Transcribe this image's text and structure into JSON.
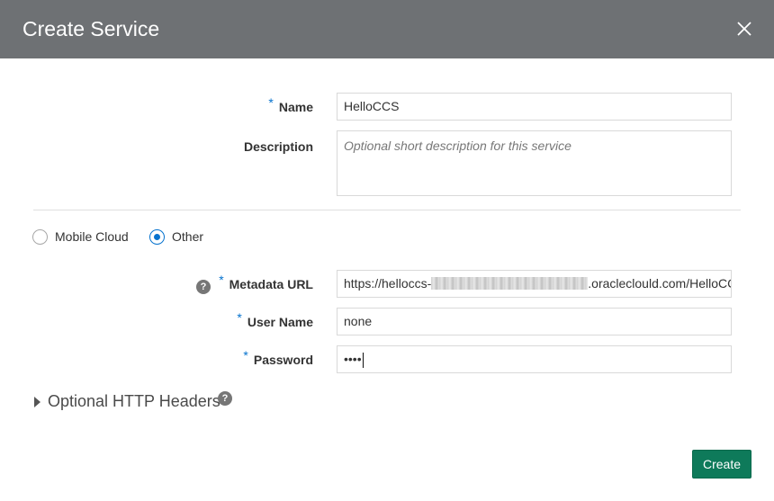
{
  "dialog": {
    "title": "Create Service",
    "close_icon": "close-icon"
  },
  "form": {
    "required_marker": "*",
    "name": {
      "label": "Name",
      "value": "HelloCCS"
    },
    "description": {
      "label": "Description",
      "placeholder": "Optional short description for this service"
    },
    "service_type": {
      "options": [
        {
          "label": "Mobile Cloud",
          "checked": false
        },
        {
          "label": "Other",
          "checked": true
        }
      ]
    },
    "metadata_url": {
      "label": "Metadata URL",
      "value_prefix": "https://helloccs-",
      "value_suffix": ".oracleclould.com/HelloCC",
      "help_icon": "help-icon"
    },
    "user_name": {
      "label": "User Name",
      "value": "none"
    },
    "password": {
      "label": "Password",
      "value": "••••"
    },
    "optional_headers": {
      "label": "Optional HTTP Headers",
      "help_icon": "help-icon"
    }
  },
  "actions": {
    "create_label": "Create"
  },
  "colors": {
    "titlebar": "#6e7174",
    "accent_blue": "#0572ce",
    "primary_button": "#0e7a5a"
  }
}
